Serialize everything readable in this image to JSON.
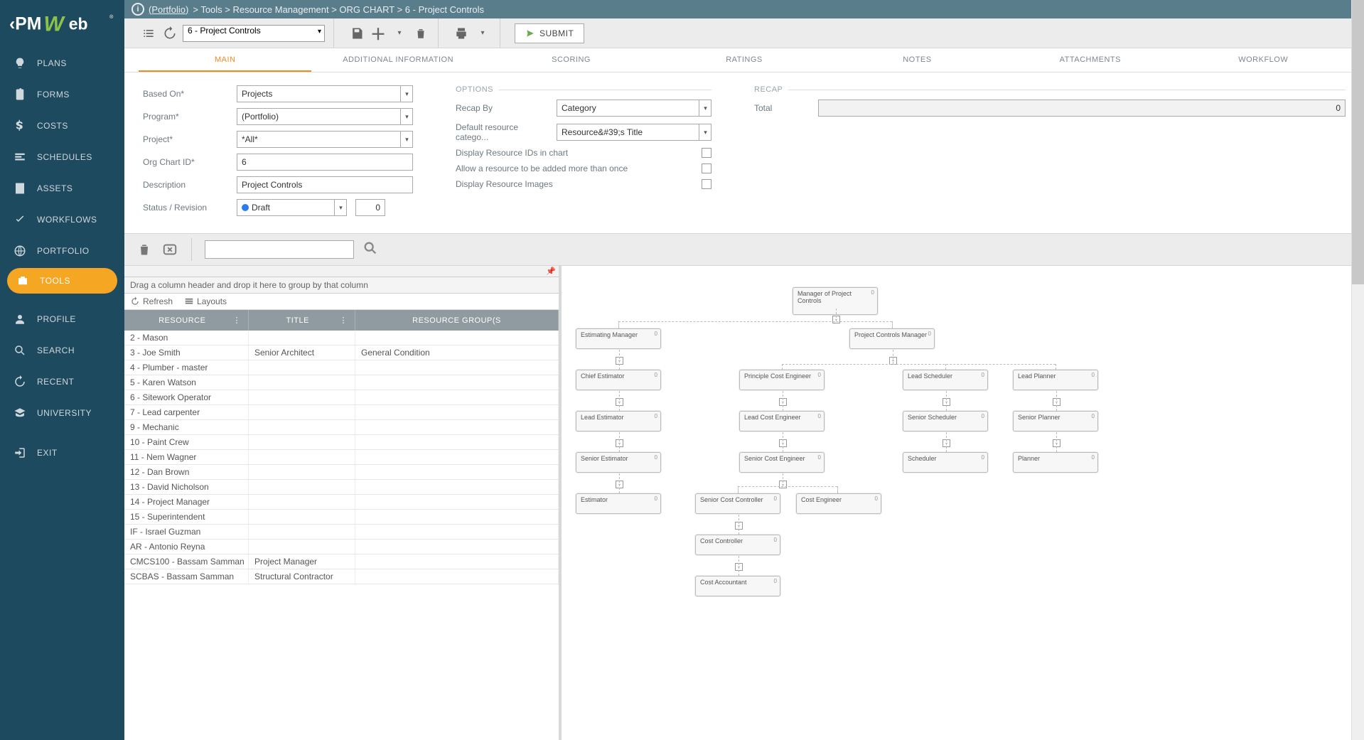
{
  "breadcrumb": {
    "portfolio": "(Portfolio)",
    "rest": "> Tools > Resource Management > ORG CHART > 6 - Project Controls"
  },
  "toolbar": {
    "selector": "6 -  Project Controls",
    "submit": "SUBMIT"
  },
  "tabs": [
    "MAIN",
    "ADDITIONAL INFORMATION",
    "SCORING",
    "RATINGS",
    "NOTES",
    "ATTACHMENTS",
    "WORKFLOW"
  ],
  "form": {
    "based_on_label": "Based On*",
    "based_on": "Projects",
    "program_label": "Program*",
    "program": "(Portfolio)",
    "project_label": "Project*",
    "project": "*All*",
    "orgchartid_label": "Org Chart ID*",
    "orgchartid": "6",
    "description_label": "Description",
    "description": "Project Controls",
    "status_label": "Status / Revision",
    "status": "Draft",
    "revision": "0"
  },
  "options": {
    "header": "OPTIONS",
    "recap_by_label": "Recap By",
    "recap_by": "Category",
    "default_cat_label": "Default resource catego...",
    "default_cat": "Resource&#39;s Title",
    "display_ids": "Display Resource IDs in chart",
    "allow_more": "Allow a resource to be added more than once",
    "display_images": "Display Resource Images"
  },
  "recap": {
    "header": "RECAP",
    "total_label": "Total",
    "total_value": "0"
  },
  "grid": {
    "group_drop": "Drag a column header and drop it here to group by that column",
    "refresh": "Refresh",
    "layouts": "Layouts",
    "col1": "RESOURCE",
    "col2": "TITLE",
    "col3": "RESOURCE GROUP(S",
    "rows": [
      {
        "r": "2 - Mason",
        "t": "",
        "g": ""
      },
      {
        "r": "3 - Joe Smith",
        "t": "Senior Architect",
        "g": "General Condition"
      },
      {
        "r": "4 - Plumber - master",
        "t": "",
        "g": ""
      },
      {
        "r": "5 - Karen Watson",
        "t": "",
        "g": ""
      },
      {
        "r": "6 - Sitework Operator",
        "t": "",
        "g": ""
      },
      {
        "r": "7 - Lead carpenter",
        "t": "",
        "g": ""
      },
      {
        "r": "9 - Mechanic",
        "t": "",
        "g": ""
      },
      {
        "r": "10 - Paint Crew",
        "t": "",
        "g": ""
      },
      {
        "r": "11 - Nem Wagner",
        "t": "",
        "g": ""
      },
      {
        "r": "12 - Dan Brown",
        "t": "",
        "g": ""
      },
      {
        "r": "13 - David Nicholson",
        "t": "",
        "g": ""
      },
      {
        "r": "14 - Project Manager",
        "t": "",
        "g": ""
      },
      {
        "r": "15 - Superintendent",
        "t": "",
        "g": ""
      },
      {
        "r": "IF - Israel Guzman",
        "t": "",
        "g": ""
      },
      {
        "r": "AR - Antonio Reyna",
        "t": "",
        "g": ""
      },
      {
        "r": "CMCS100 - Bassam Samman",
        "t": "Project Manager",
        "g": ""
      },
      {
        "r": "SCBAS - Bassam Samman",
        "t": "Structural Contractor",
        "g": ""
      }
    ]
  },
  "sidebar": {
    "items": [
      {
        "label": "PLANS"
      },
      {
        "label": "FORMS"
      },
      {
        "label": "COSTS"
      },
      {
        "label": "SCHEDULES"
      },
      {
        "label": "ASSETS"
      },
      {
        "label": "WORKFLOWS"
      },
      {
        "label": "PORTFOLIO"
      },
      {
        "label": "TOOLS"
      },
      {
        "label": "PROFILE"
      },
      {
        "label": "SEARCH"
      },
      {
        "label": "RECENT"
      },
      {
        "label": "UNIVERSITY"
      },
      {
        "label": "EXIT"
      }
    ]
  },
  "org": {
    "nodes": [
      {
        "key": "n0",
        "label": "Manager of Project Controls"
      },
      {
        "key": "n1",
        "label": "Estimating Manager"
      },
      {
        "key": "n2",
        "label": "Project Controls Manager"
      },
      {
        "key": "n3",
        "label": "Chief Estimator"
      },
      {
        "key": "n4",
        "label": "Principle Cost Engineer"
      },
      {
        "key": "n5",
        "label": "Lead Scheduler"
      },
      {
        "key": "n6",
        "label": "Lead Planner"
      },
      {
        "key": "n7",
        "label": "Lead Estimator"
      },
      {
        "key": "n8",
        "label": "Lead Cost Engineer"
      },
      {
        "key": "n9",
        "label": "Senior Scheduler"
      },
      {
        "key": "n10",
        "label": "Senior Planner"
      },
      {
        "key": "n11",
        "label": "Senior Estimator"
      },
      {
        "key": "n12",
        "label": "Senior Cost Engineer"
      },
      {
        "key": "n13",
        "label": "Scheduler"
      },
      {
        "key": "n14",
        "label": "Planner"
      },
      {
        "key": "n15",
        "label": "Estimator"
      },
      {
        "key": "n16",
        "label": "Senior Cost Controller"
      },
      {
        "key": "n17",
        "label": "Cost Engineer"
      },
      {
        "key": "n18",
        "label": "Cost Controller"
      },
      {
        "key": "n19",
        "label": "Cost Accountant"
      }
    ]
  }
}
